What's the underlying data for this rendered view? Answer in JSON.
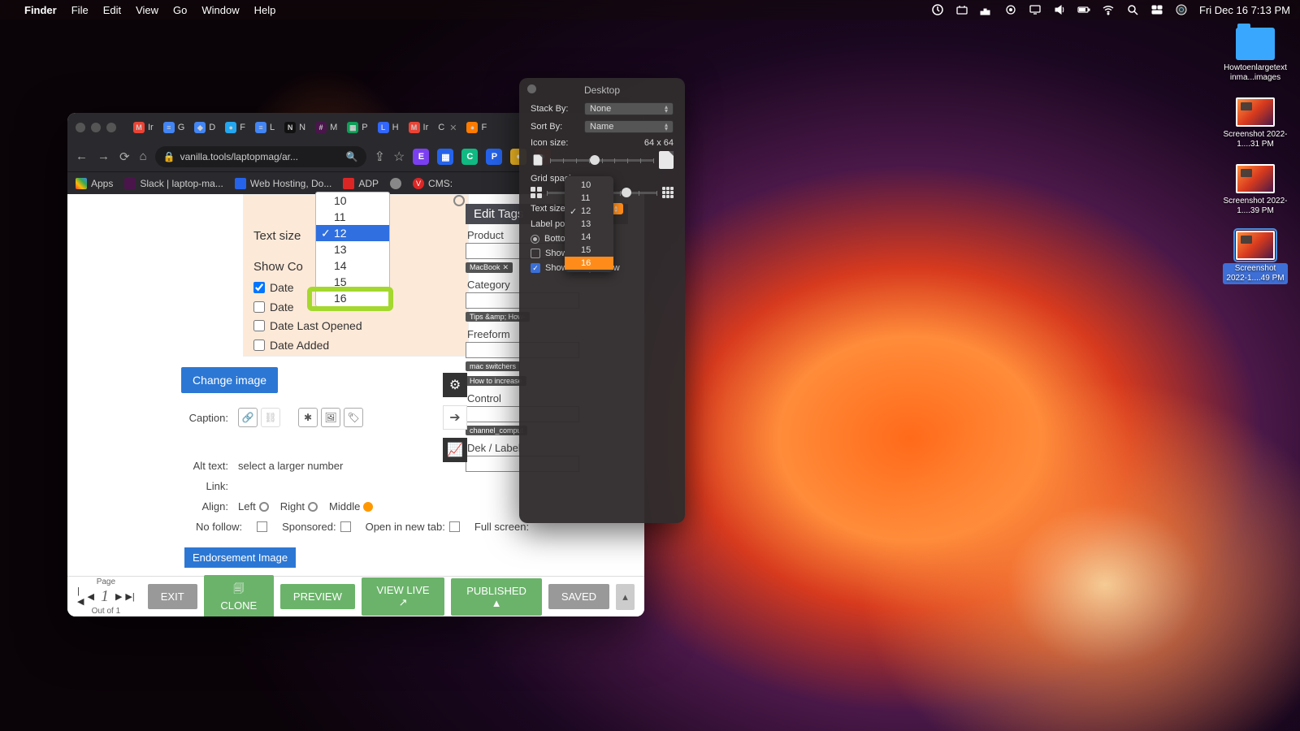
{
  "menubar": {
    "app": "Finder",
    "items": [
      "File",
      "Edit",
      "View",
      "Go",
      "Window",
      "Help"
    ],
    "datetime": "Fri Dec 16  7:13 PM"
  },
  "desktop": {
    "folder": "Howtoenlargetextinma...images",
    "shots": [
      "Screenshot 2022-1....31 PM",
      "Screenshot 2022-1....39 PM",
      "Screenshot 2022-1....49 PM"
    ]
  },
  "browser": {
    "tabs": [
      "Ir",
      "G",
      "D",
      "F",
      "L",
      "N",
      "M",
      "P",
      "H",
      "Ir",
      "C",
      "F"
    ],
    "url": "vanilla.tools/laptopmag/ar...",
    "bookmarks": {
      "apps": "Apps",
      "slack": "Slack | laptop-ma...",
      "web": "Web Hosting, Do...",
      "adp": "ADP",
      "cms": "CMS:"
    }
  },
  "innerpane": {
    "textsize_label": "Text size",
    "showcols": "Show Co",
    "opts": [
      "10",
      "11",
      "12",
      "13",
      "14",
      "15",
      "16"
    ],
    "rows": {
      "modified": "Date",
      "created": "Date",
      "opened": "Date Last Opened",
      "added": "Date Added"
    }
  },
  "tags": {
    "header": "Edit Tags",
    "product": "Product",
    "product_tag": "MacBook",
    "category": "Category",
    "category_tag": "Tips &amp; How-",
    "freeform": "Freeform",
    "free_tags": [
      "mac switchers",
      "How to increase"
    ],
    "control": "Control",
    "control_tag": "channel_comput",
    "dek": "Dek / Label"
  },
  "form": {
    "change": "Change image",
    "caption": "Caption:",
    "alt_label": "Alt text:",
    "alt_value": "select a larger number",
    "link": "Link:",
    "align": "Align:",
    "align_opts": [
      "Left",
      "Right",
      "Middle"
    ],
    "nofollow": "No follow:",
    "sponsored": "Sponsored:",
    "newtab": "Open in new tab:",
    "fullscreen": "Full screen:",
    "endorse": "Endorsement Image"
  },
  "footer": {
    "page_label": "Page",
    "page_num": "1",
    "outof": "Out of 1",
    "exit": "EXIT",
    "clone": "CLONE",
    "preview": "PREVIEW",
    "viewlive": "VIEW LIVE",
    "published": "PUBLISHED",
    "saved": "SAVED"
  },
  "viewopts": {
    "title": "Desktop",
    "stackby_label": "Stack By:",
    "stackby_value": "None",
    "sortby_label": "Sort By:",
    "sortby_value": "Name",
    "iconsize_label": "Icon size:",
    "iconsize_value": "64 x 64",
    "gridspacing": "Grid spacing:",
    "textsize_label": "Text size",
    "labelpos": "Label po",
    "bottom": "Botto",
    "showinfo": "Show",
    "showpreview": "Show icon preview"
  },
  "tspopup": {
    "opts": [
      "10",
      "11",
      "12",
      "13",
      "14",
      "15",
      "16"
    ]
  }
}
